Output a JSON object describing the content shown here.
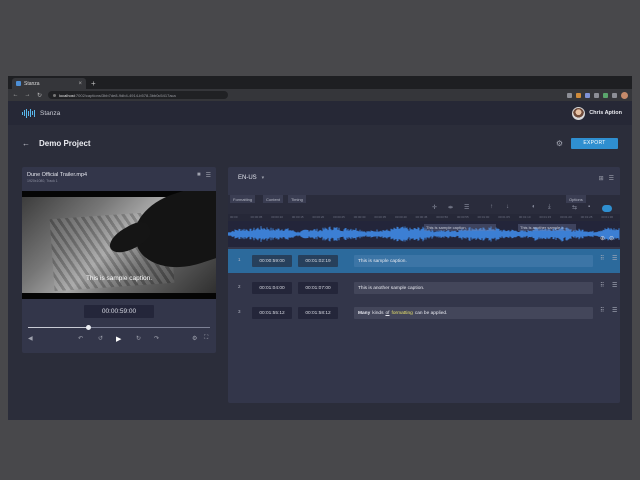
{
  "browser": {
    "tab_title": "Stanza",
    "tab_close": "×",
    "new_tab": "+",
    "nav": {
      "back": "←",
      "forward": "→",
      "reload": "↻"
    },
    "url_host": "localhost",
    "url_path": ":7002/captions/3bb7de8-9db4-4914-b578-3bb0c5417aca"
  },
  "app": {
    "logo_text": "Stanza",
    "user_name": "Chris Aption",
    "back_arrow": "←",
    "project_title": "Demo Project",
    "settings_glyph": "⚙",
    "export_label": "EXPORT"
  },
  "video": {
    "file_name": "Dune Official Trailer.mp4",
    "meta": "1920x1080, Track 1",
    "folder_glyph": "■",
    "menu_glyph": "☰",
    "caption_overlay": "This is sample caption.",
    "current_time": "00:00:59:00",
    "progress": 0.33,
    "controls": {
      "volume": "◀",
      "back_far": "↶",
      "back": "↺",
      "play": "▶",
      "forward": "↻",
      "forward_far": "↷",
      "settings": "⚙",
      "fullscreen": "⛶"
    }
  },
  "captions": {
    "language": "EN-US",
    "language_caret": "▾",
    "header_icons": [
      "⊞",
      "☰"
    ],
    "tabs": [
      "Formatting",
      "Content",
      "Timing"
    ],
    "options_tab": "Options",
    "tools": [
      "✛",
      "⇹",
      "☰",
      "↑",
      "↓",
      "◐",
      "⤓",
      "⇆",
      "▪"
    ],
    "ruler_ticks": [
      "00:00",
      "00:00:05",
      "00:00:10",
      "00:00:15",
      "00:00:20",
      "00:00:25",
      "00:00:30",
      "00:00:35",
      "00:00:40",
      "00:00:45",
      "00:00:50",
      "00:00:55",
      "00:01:00",
      "00:01:05",
      "00:01:10",
      "00:01:15",
      "00:01:20",
      "00:01:25",
      "00:01:30"
    ],
    "wave_regions": [
      "This is sample caption.",
      "This is another sample c..."
    ],
    "zoom_glyphs": [
      "⊕",
      "⊖"
    ],
    "row_icons": {
      "grid": "⠿",
      "menu": "☰"
    },
    "rows": [
      {
        "num": "1",
        "start": "00:00:59:00",
        "end": "00:01:02:19",
        "text": "This is sample caption."
      },
      {
        "num": "2",
        "start": "00:01:04:00",
        "end": "00:01:07:00",
        "text": "This is another sample caption."
      },
      {
        "num": "3",
        "start": "00:01:55:12",
        "end": "00:01:58:12",
        "text_parts": {
          "bold": "Many",
          "plain1": "kinds",
          "underline": "of",
          "highlight": "formatting",
          "plain2": "can be applied."
        }
      }
    ]
  },
  "colors": {
    "accent": "#2f8fd0",
    "selected_row": "#2c6a9c",
    "waveform": "#3c7fd4",
    "highlight_text": "#e9e36a"
  }
}
